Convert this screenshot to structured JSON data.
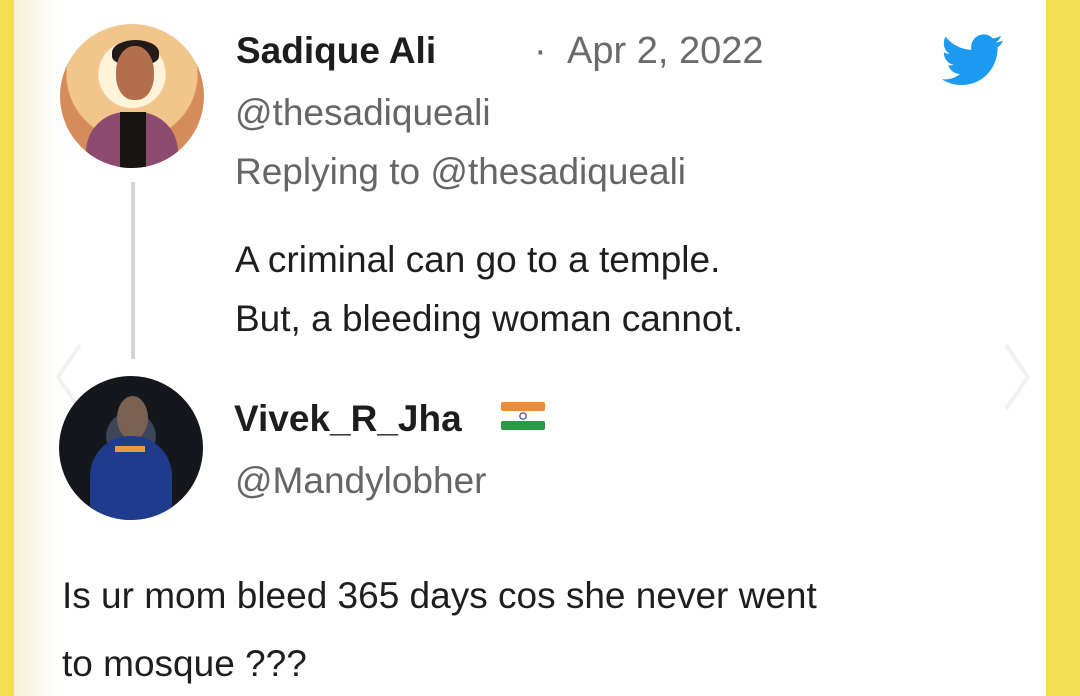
{
  "tweet1": {
    "author": "Sadique Ali",
    "date_separator": "·",
    "date": "Apr 2, 2022",
    "handle": "@thesadiqueali",
    "reply_to": "Replying to @thesadiqueali",
    "line1": "A criminal can go to a temple.",
    "line2": "But, a bleeding woman cannot."
  },
  "tweet2": {
    "author": "Vivek_R_Jha",
    "handle": "@Mandylobher",
    "line1": "Is ur mom bleed 365 days cos she never went",
    "line2": "to mosque ???"
  },
  "icons": {
    "brand": "twitter-bird-icon",
    "flag": "india-flag-icon",
    "left_arrow": "chevron-left-icon",
    "right_arrow": "chevron-right-icon"
  },
  "colors": {
    "frame": "#f3df52",
    "twitter_blue": "#1d9bf0"
  }
}
